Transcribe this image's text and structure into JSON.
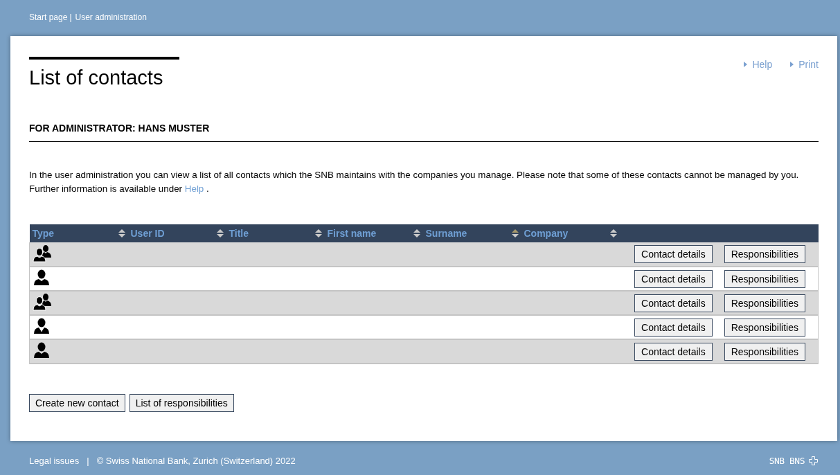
{
  "breadcrumb": {
    "items": [
      "Start page",
      "User administration"
    ],
    "separator": "|"
  },
  "page": {
    "title": "List of contacts",
    "links": [
      "Help",
      "Print"
    ],
    "subtitle": "FOR ADMINISTRATOR: HANS MUSTER",
    "intro": {
      "text": "In the user administration you can view a list of all contacts which the SNB maintains with the companies you manage. Please note that some of these contacts cannot be managed by you. Further information is available under",
      "link": "Help",
      "after": " ."
    }
  },
  "table": {
    "columns": [
      {
        "label": "Type",
        "sorted": false
      },
      {
        "label": "User ID",
        "sorted": false
      },
      {
        "label": "Title",
        "sorted": false
      },
      {
        "label": "First name",
        "sorted": false
      },
      {
        "label": "Surname",
        "sorted": true
      },
      {
        "label": "Company",
        "sorted": false
      }
    ],
    "rows": [
      {
        "kind": "group",
        "actions": [
          "Contact details",
          "Responsibilities"
        ]
      },
      {
        "kind": "person",
        "actions": [
          "Contact details",
          "Responsibilities"
        ]
      },
      {
        "kind": "group",
        "actions": [
          "Contact details",
          "Responsibilities"
        ]
      },
      {
        "kind": "person-tie",
        "actions": [
          "Contact details",
          "Responsibilities"
        ]
      },
      {
        "kind": "person",
        "actions": [
          "Contact details",
          "Responsibilities"
        ]
      }
    ]
  },
  "buttons": [
    "Create new contact",
    "List of responsibilities"
  ],
  "footer": {
    "legal_link": "Legal issues",
    "separator": "|",
    "copyright": "© Swiss National Bank, Zurich (Switzerland) 2022",
    "logo_text": "SNB BNS"
  }
}
